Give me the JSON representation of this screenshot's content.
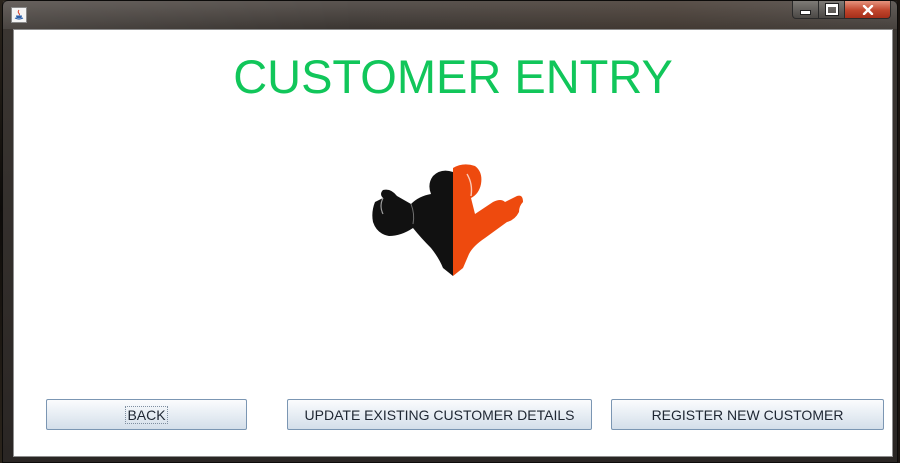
{
  "window": {
    "controls": {
      "minimize_icon": "minimize-icon",
      "maximize_icon": "maximize-icon",
      "close_icon": "close-icon"
    }
  },
  "page": {
    "title": "CUSTOMER ENTRY",
    "logo_icon": "gym-couple-flexing-logo",
    "title_color": "#11c65a"
  },
  "buttons": {
    "back": "BACK",
    "update": "UPDATE EXISTING CUSTOMER DETAILS",
    "register": "REGISTER NEW CUSTOMER"
  },
  "colors": {
    "logo_dark": "#111111",
    "logo_accent": "#ee4a0e"
  }
}
